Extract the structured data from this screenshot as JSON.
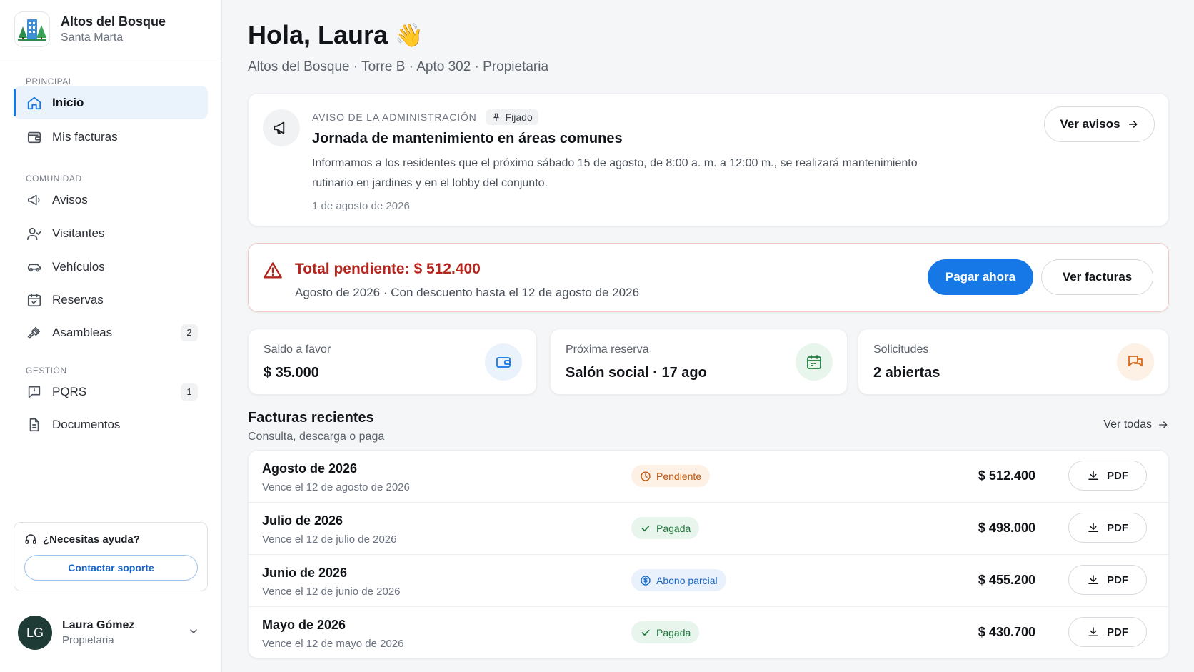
{
  "brand": {
    "name": "Altos del Bosque",
    "city": "Santa Marta"
  },
  "nav": {
    "sections": {
      "principal": "PRINCIPAL",
      "comunidad": "COMUNIDAD",
      "gestion": "GESTIÓN"
    },
    "items": [
      {
        "label": "Inicio",
        "icon": "home-icon",
        "active": true
      },
      {
        "label": "Mis facturas",
        "icon": "wallet-icon"
      },
      {
        "label": "Avisos",
        "icon": "megaphone-icon"
      },
      {
        "label": "Visitantes",
        "icon": "user-check-icon"
      },
      {
        "label": "Vehículos",
        "icon": "car-icon"
      },
      {
        "label": "Reservas",
        "icon": "calendar-check-icon"
      },
      {
        "label": "Asambleas",
        "icon": "gavel-icon",
        "badge": "2"
      },
      {
        "label": "PQRS",
        "icon": "message-alert-icon",
        "badge": "1"
      },
      {
        "label": "Documentos",
        "icon": "document-icon"
      }
    ]
  },
  "help": {
    "title": "¿Necesitas ayuda?",
    "button": "Contactar soporte"
  },
  "user": {
    "initials": "LG",
    "name": "Laura Gómez",
    "role": "Propietaria"
  },
  "header": {
    "greeting": "Hola, Laura",
    "emoji": "👋",
    "subtitle": "Altos del Bosque · Torre B · Apto 302 · Propietaria"
  },
  "notice": {
    "label": "AVISO DE LA ADMINISTRACIÓN",
    "tag": "Fijado",
    "title": "Jornada de mantenimiento en áreas comunes",
    "body": "Informamos a los residentes que el próximo sábado 15 de agosto, de 8:00 a. m. a 12:00 m., se realizará mantenimiento rutinario en jardines y en el lobby del conjunto.",
    "date": "1 de agosto de 2026",
    "button": "Ver avisos"
  },
  "alert": {
    "title": "Total pendiente: $ 512.400",
    "subtitle": "Agosto de 2026 · Con descuento hasta el 12 de agosto de 2026",
    "primary_button": "Pagar ahora",
    "secondary_button": "Ver facturas",
    "color": "#b3261e"
  },
  "stats": [
    {
      "label": "Saldo a favor",
      "value": "$ 35.000",
      "icon": "wallet-icon",
      "color": "#1677e6",
      "bg": "#eaf2fb"
    },
    {
      "label": "Próxima reserva",
      "value": "Salón social · 17 ago",
      "icon": "calendar-icon",
      "color": "#1f7a3d",
      "bg": "#e8f5ec"
    },
    {
      "label": "Solicitudes",
      "value": "2 abiertas",
      "icon": "chat-icon",
      "color": "#d9691a",
      "bg": "#fdf0e4"
    }
  ],
  "invoices": {
    "title": "Facturas recientes",
    "subtitle": "Consulta, descarga o paga",
    "see_all": "Ver todas",
    "pdf_label": "PDF",
    "rows": [
      {
        "period": "Agosto de 2026",
        "due": "Vence el 12 de agosto de 2026",
        "status": "Pendiente",
        "status_type": "pending",
        "amount": "$ 512.400"
      },
      {
        "period": "Julio de 2026",
        "due": "Vence el 12 de julio de 2026",
        "status": "Pagada",
        "status_type": "paid",
        "amount": "$ 498.000"
      },
      {
        "period": "Junio de 2026",
        "due": "Vence el 12 de junio de 2026",
        "status": "Abono parcial",
        "status_type": "partial",
        "amount": "$ 455.200"
      },
      {
        "period": "Mayo de 2026",
        "due": "Vence el 12 de mayo de 2026",
        "status": "Pagada",
        "status_type": "paid",
        "amount": "$ 430.700"
      }
    ]
  }
}
